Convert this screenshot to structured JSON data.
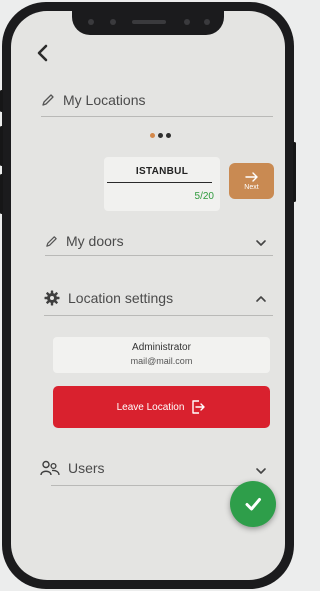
{
  "locations": {
    "title": "My Locations",
    "city": "ISTANBUL",
    "count": "5/20",
    "next_label": "Next"
  },
  "doors": {
    "title": "My doors"
  },
  "location_settings": {
    "title": "Location settings",
    "role": "Administrator",
    "email": "mail@mail.com",
    "leave_label": "Leave Location"
  },
  "users": {
    "title": "Users"
  },
  "colors": {
    "accent_orange": "#c98a52",
    "danger_red": "#d9212e",
    "success_green": "#2e9e4a"
  },
  "icons": [
    "chevron-left-icon",
    "pencil-icon",
    "gear-icon",
    "users-icon",
    "arrow-right-icon",
    "exit-icon",
    "checkmark-icon",
    "chevron-down-icon",
    "chevron-up-icon"
  ]
}
